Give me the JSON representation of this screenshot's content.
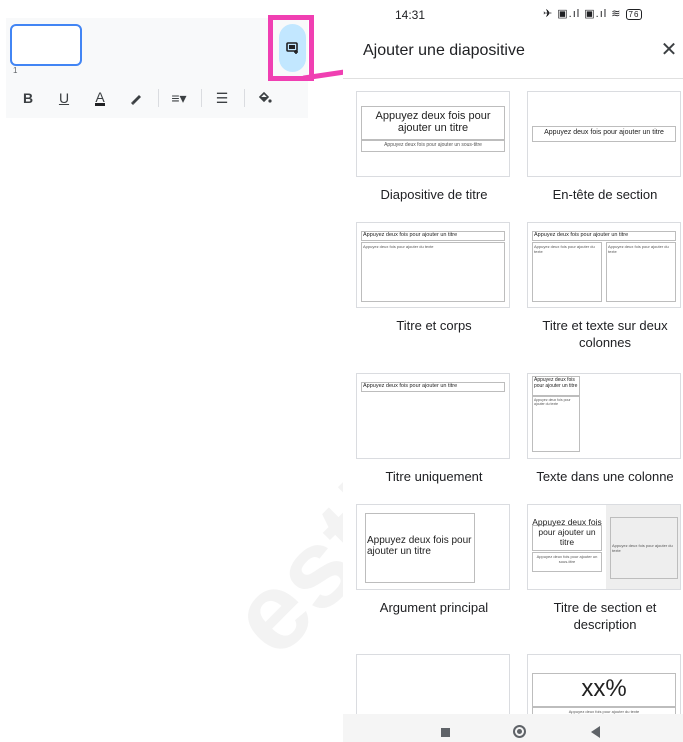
{
  "editor": {
    "slide_number": "1",
    "toolbar": {
      "bold": "B",
      "underline": "U",
      "text_color": "A",
      "align": "≡▾",
      "list": "☰"
    }
  },
  "watermark": "esti",
  "status": {
    "time": "14:31",
    "icons": "✈ ▣.ıl ▣.ıl ≋",
    "battery": "76"
  },
  "sheet": {
    "title": "Ajouter une diapositive",
    "close": "✕"
  },
  "layouts": [
    {
      "label": "Diapositive de titre",
      "title_text": "Appuyez deux fois pour ajouter un titre",
      "sub_text": "Appuyez deux fois pour ajouter un sous-titre"
    },
    {
      "label": "En-tête de section",
      "title_text": "Appuyez deux fois pour ajouter un titre"
    },
    {
      "label": "Titre et corps",
      "title_text": "Appuyez deux fois pour ajouter un titre",
      "body_text": "Appuyez deux fois pour ajouter du texte"
    },
    {
      "label": "Titre et texte sur deux colonnes",
      "title_text": "Appuyez deux fois pour ajouter un titre",
      "body_text": "Appuyez deux fois pour ajouter du texte"
    },
    {
      "label": "Titre uniquement",
      "title_text": "Appuyez deux fois pour ajouter un titre"
    },
    {
      "label": "Texte dans une colonne",
      "title_text": "Appuyez deux fois pour ajouter un titre",
      "body_text": "Appuyez deux fois pour ajouter du texte"
    },
    {
      "label": "Argument principal",
      "title_text": "Appuyez deux fois pour ajouter un titre"
    },
    {
      "label": "Titre de section et description",
      "title_text": "Appuyez deux fois pour ajouter un titre",
      "sub_text": "Appuyez deux fois pour ajouter un sous-titre",
      "body_text": "Appuyez deux fois pour ajouter du texte"
    },
    {
      "label": ""
    },
    {
      "label": "",
      "big_text": "xx%",
      "body_text": "Appuyez deux fois pour ajouter du texte"
    }
  ],
  "colors": {
    "highlight": "#f03fb2",
    "selected_button": "#c2e7ff",
    "thumbnail_border": "#4285f4"
  }
}
